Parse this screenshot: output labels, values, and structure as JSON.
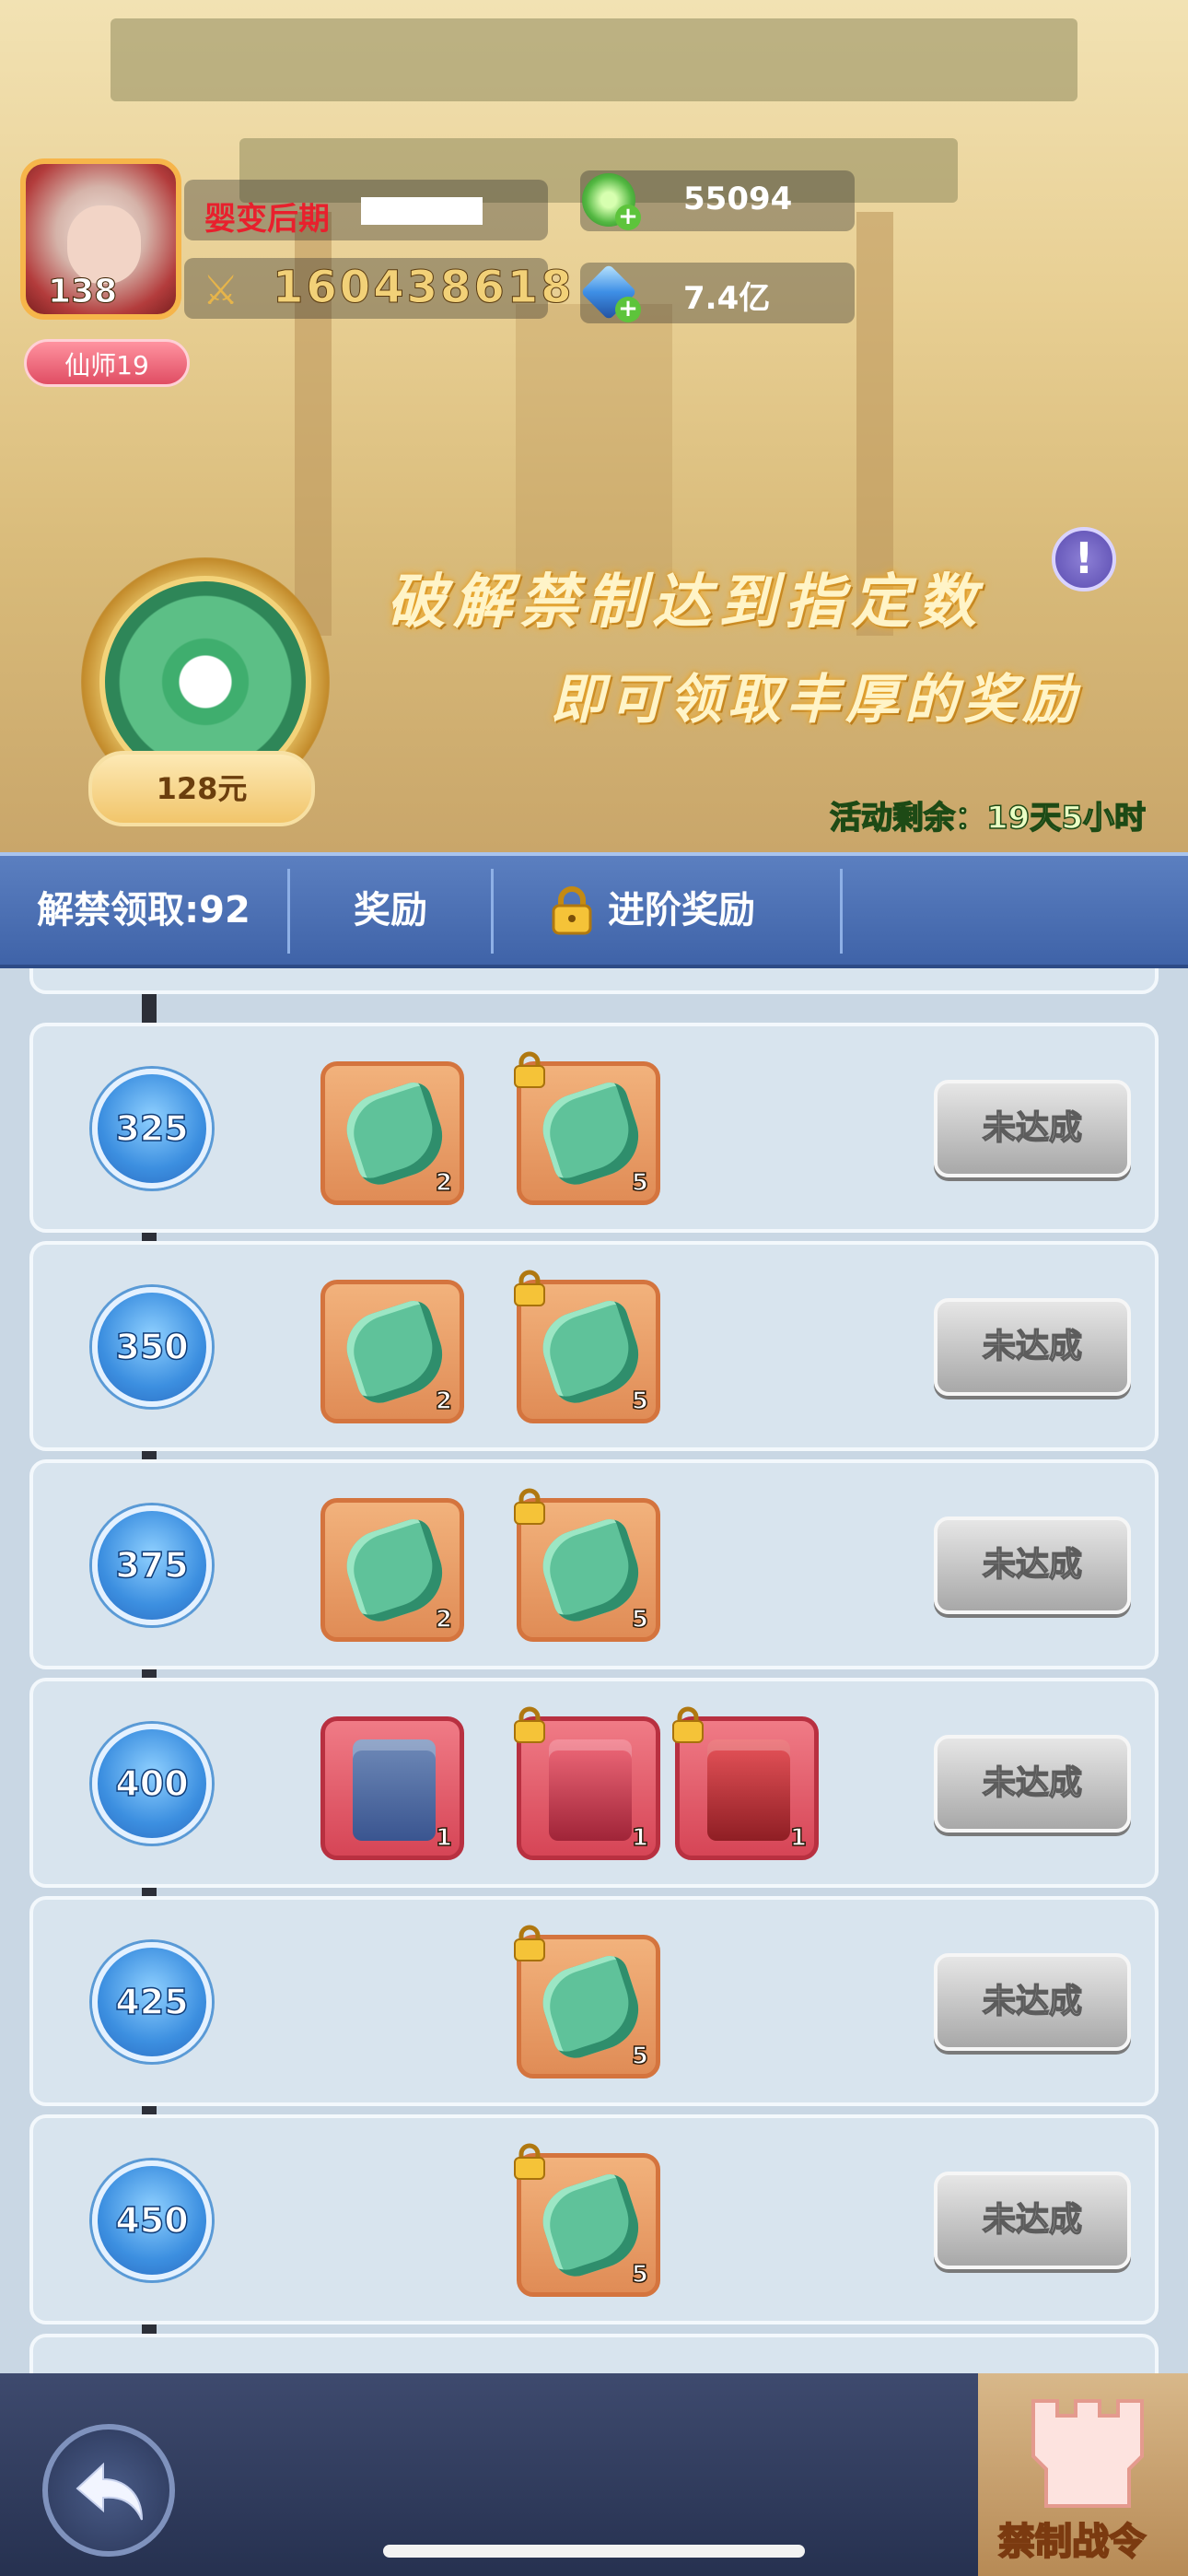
{
  "player": {
    "avatar_level": "138",
    "title_badge": "仙师19",
    "realm": "婴变后期",
    "power": "160438618"
  },
  "resources": [
    {
      "icon": "jade-coin-icon",
      "value": "55094"
    },
    {
      "icon": "crystal-icon",
      "value": "7.4亿"
    }
  ],
  "promo": {
    "line1": "破解禁制达到指定数",
    "line2": "即可领取丰厚的奖励",
    "price": "128元",
    "remaining": "活动剩余：19天5小时"
  },
  "tabs": {
    "unlock_count": "解禁领取:92",
    "reward": "奖励",
    "advanced_reward": "进阶奖励"
  },
  "rows": [
    {
      "milestone": "325",
      "items": [
        {
          "kind": "jade",
          "count": "2",
          "locked": false
        },
        {
          "kind": "jade",
          "count": "5",
          "locked": true
        }
      ],
      "status": "未达成"
    },
    {
      "milestone": "350",
      "items": [
        {
          "kind": "jade",
          "count": "2",
          "locked": false
        },
        {
          "kind": "jade",
          "count": "5",
          "locked": true
        }
      ],
      "status": "未达成"
    },
    {
      "milestone": "375",
      "items": [
        {
          "kind": "jade",
          "count": "2",
          "locked": false
        },
        {
          "kind": "jade",
          "count": "5",
          "locked": true
        }
      ],
      "status": "未达成"
    },
    {
      "milestone": "400",
      "items": [
        {
          "kind": "blue-box",
          "count": "1",
          "locked": false
        },
        {
          "kind": "red-box",
          "count": "1",
          "locked": true
        },
        {
          "kind": "red-altar",
          "count": "1",
          "locked": true
        }
      ],
      "status": "未达成"
    },
    {
      "milestone": "425",
      "items": [
        {
          "kind": "jade",
          "count": "5",
          "locked": true
        }
      ],
      "status": "未达成"
    },
    {
      "milestone": "450",
      "items": [
        {
          "kind": "jade",
          "count": "5",
          "locked": true
        }
      ],
      "status": "未达成"
    }
  ],
  "bottom": {
    "order_label": "禁制战令"
  },
  "colors": {
    "tab_bar": "#4a6eb4",
    "node_blue": "#3c8fe0",
    "item_orange": "#e08c56",
    "item_red": "#d64556",
    "button_gray": "#b8b8b8"
  }
}
